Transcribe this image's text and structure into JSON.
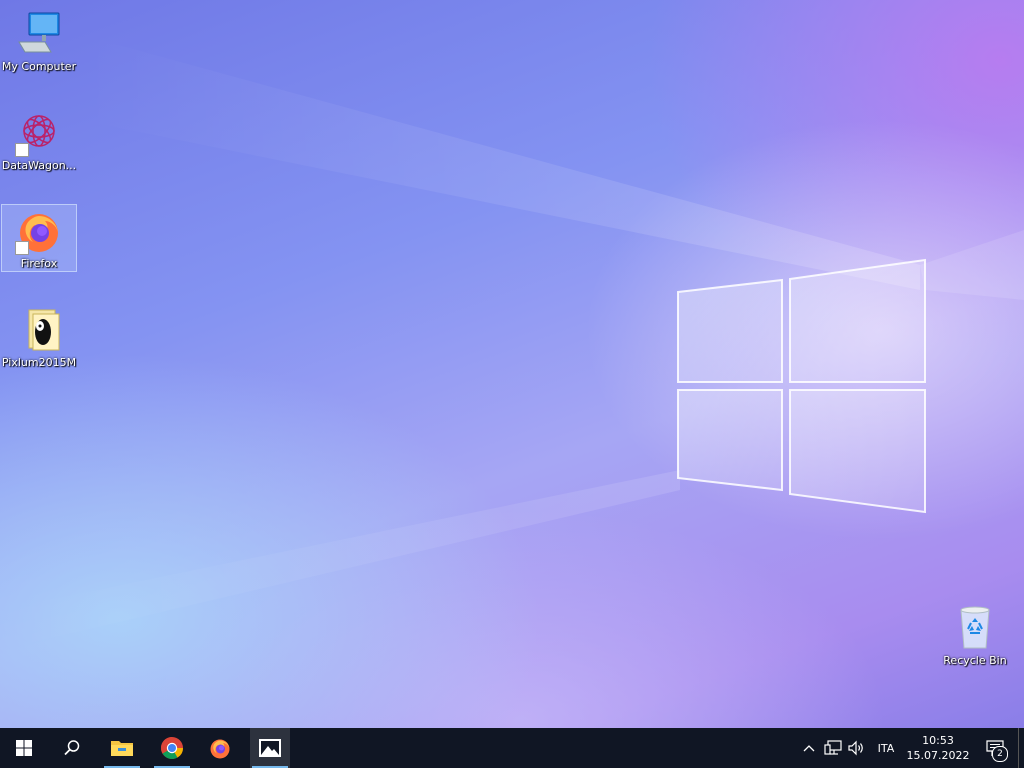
{
  "desktop": {
    "icons": [
      {
        "label": "My Computer",
        "icon": "computer-icon"
      },
      {
        "label": "DataWagon...",
        "icon": "datawagon-icon"
      },
      {
        "label": "Firefox",
        "icon": "firefox-icon"
      },
      {
        "label": "Pixlum2015M",
        "icon": "pixlum-icon"
      }
    ],
    "recycle_bin": {
      "label": "Recycle Bin",
      "icon": "recycle-bin-icon"
    }
  },
  "taskbar": {
    "start": {
      "icon": "windows-start-icon"
    },
    "search": {
      "icon": "search-icon"
    },
    "pinned": [
      {
        "name": "File Explorer",
        "icon": "file-explorer-icon"
      },
      {
        "name": "Chrome",
        "icon": "chrome-icon"
      },
      {
        "name": "Firefox",
        "icon": "firefox-icon"
      },
      {
        "name": "Photos",
        "icon": "photos-icon"
      }
    ],
    "tray": {
      "language": "ITA",
      "time": "10:53",
      "date": "15.07.2022",
      "notification_count": "2"
    }
  },
  "colors": {
    "taskbar_bg": "#101624",
    "running_indicator": "#76b9ed"
  }
}
